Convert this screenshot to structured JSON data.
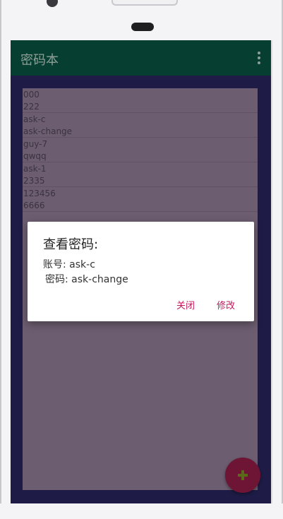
{
  "app": {
    "title": "密码本",
    "overflow_icon": "more-vert-icon"
  },
  "entries": [
    {
      "account": "000",
      "password": "222"
    },
    {
      "account": "ask-c",
      "password": "ask-change"
    },
    {
      "account": "guy-7",
      "password": "qwqq"
    },
    {
      "account": "ask-1",
      "password": "2335"
    },
    {
      "account": "123456",
      "password": "6666"
    }
  ],
  "dialog": {
    "title": "查看密码:",
    "account_label": "账号:",
    "account_value": "ask-c",
    "password_label": "密码:",
    "password_value": "ask-change",
    "close_label": "关闭",
    "edit_label": "修改"
  },
  "fab": {
    "icon": "plus-icon"
  },
  "colors": {
    "appbar": "#063f32",
    "screen_bg": "#1e1c46",
    "list_bg": "#6c5d70",
    "accent": "#c2185b",
    "fab": "#6e1536"
  }
}
